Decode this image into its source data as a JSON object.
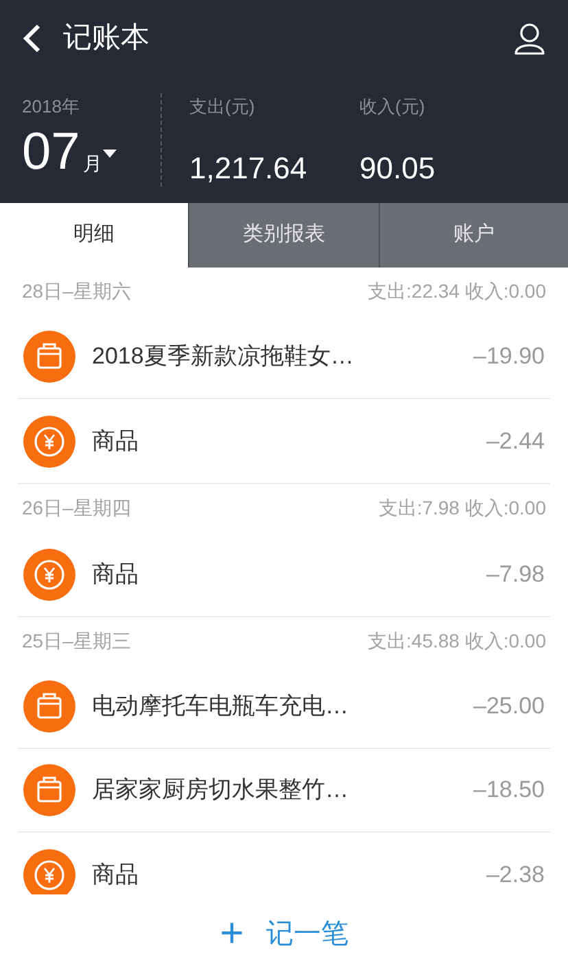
{
  "header": {
    "title": "记账本"
  },
  "summary": {
    "year": "2018年",
    "month": "07",
    "month_unit": "月",
    "expense_label": "支出(元)",
    "expense": "1,217.64",
    "income_label": "收入(元)",
    "income": "90.05"
  },
  "tabs": [
    {
      "label": "明细",
      "selected": true
    },
    {
      "label": "类别报表",
      "selected": false
    },
    {
      "label": "账户",
      "selected": false
    }
  ],
  "groups": [
    {
      "date": "28日–星期六",
      "totals": "支出:22.34 收入:0.00",
      "items": [
        {
          "kind": "bag",
          "name": "2018夏季新款凉拖鞋女…",
          "amount": "–19.90"
        },
        {
          "kind": "yuan",
          "name": "商品",
          "amount": "–2.44"
        }
      ]
    },
    {
      "date": "26日–星期四",
      "totals": "支出:7.98 收入:0.00",
      "items": [
        {
          "kind": "yuan",
          "name": "商品",
          "amount": "–7.98"
        }
      ]
    },
    {
      "date": "25日–星期三",
      "totals": "支出:45.88 收入:0.00",
      "items": [
        {
          "kind": "bag",
          "name": "电动摩托车电瓶车充电…",
          "amount": "–25.00"
        },
        {
          "kind": "bag",
          "name": "居家家厨房切水果整竹…",
          "amount": "–18.50"
        },
        {
          "kind": "yuan",
          "name": "商品",
          "amount": "–2.38"
        }
      ]
    }
  ],
  "footer": {
    "icon": "+",
    "label": "记一笔"
  }
}
